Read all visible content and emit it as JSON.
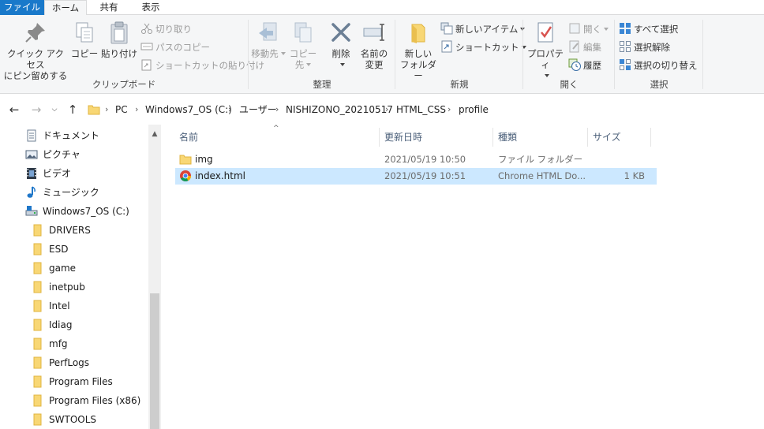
{
  "tabs": [
    {
      "label": "ファイル"
    },
    {
      "label": "ホーム"
    },
    {
      "label": "共有"
    },
    {
      "label": "表示"
    }
  ],
  "ribbon": {
    "clipboard": {
      "label": "クリップボード",
      "pin_line1": "クイック アクセス",
      "pin_line2": "にピン留めする",
      "copy": "コピー",
      "paste": "貼り付け",
      "cut": "切り取り",
      "copy_path": "パスのコピー",
      "paste_shortcut": "ショートカットの貼り付け"
    },
    "organize": {
      "label": "整理",
      "move_to": "移動先",
      "copy_to": "コピー先",
      "delete": "削除",
      "rename_line1": "名前の",
      "rename_line2": "変更"
    },
    "new": {
      "label": "新規",
      "new_folder_line1": "新しい",
      "new_folder_line2": "フォルダー",
      "new_item": "新しいアイテム",
      "shortcut": "ショートカット"
    },
    "open": {
      "label": "開く",
      "properties": "プロパティ",
      "open": "開く",
      "edit": "編集",
      "history": "履歴"
    },
    "select": {
      "label": "選択",
      "select_all": "すべて選択",
      "select_none": "選択解除",
      "invert": "選択の切り替え"
    }
  },
  "address": {
    "crumbs": [
      "PC",
      "Windows7_OS (C:)",
      "ユーザー",
      "NISHIZONO_20210517",
      "HTML_CSS",
      "profile"
    ]
  },
  "nav_pane": {
    "items": [
      {
        "label": "ドキュメント",
        "icon": "documents-icon"
      },
      {
        "label": "ピクチャ",
        "icon": "pictures-icon"
      },
      {
        "label": "ビデオ",
        "icon": "videos-icon"
      },
      {
        "label": "ミュージック",
        "icon": "music-icon"
      },
      {
        "label": "Windows7_OS (C:)",
        "icon": "drive-icon"
      },
      {
        "label": "DRIVERS",
        "icon": "folder-icon"
      },
      {
        "label": "ESD",
        "icon": "folder-icon"
      },
      {
        "label": "game",
        "icon": "folder-icon"
      },
      {
        "label": "inetpub",
        "icon": "folder-icon"
      },
      {
        "label": "Intel",
        "icon": "folder-icon"
      },
      {
        "label": "Idiag",
        "icon": "folder-icon"
      },
      {
        "label": "mfg",
        "icon": "folder-icon"
      },
      {
        "label": "PerfLogs",
        "icon": "folder-icon"
      },
      {
        "label": "Program Files",
        "icon": "folder-icon"
      },
      {
        "label": "Program Files (x86)",
        "icon": "folder-icon"
      },
      {
        "label": "SWTOOLS",
        "icon": "folder-icon"
      }
    ]
  },
  "file_list": {
    "columns": [
      "名前",
      "更新日時",
      "種類",
      "サイズ"
    ],
    "rows": [
      {
        "name": "img",
        "modified": "2021/05/19 10:50",
        "type": "ファイル フォルダー",
        "size": "",
        "icon": "folder-icon",
        "selected": false
      },
      {
        "name": "index.html",
        "modified": "2021/05/19 10:51",
        "type": "Chrome HTML Do...",
        "size": "1 KB",
        "icon": "chrome-icon",
        "selected": true
      }
    ]
  },
  "colors": {
    "accent": "#1979ca",
    "selection": "#cce8ff",
    "folder": "#f8d775",
    "ribbon_bg": "#f5f6f7"
  }
}
